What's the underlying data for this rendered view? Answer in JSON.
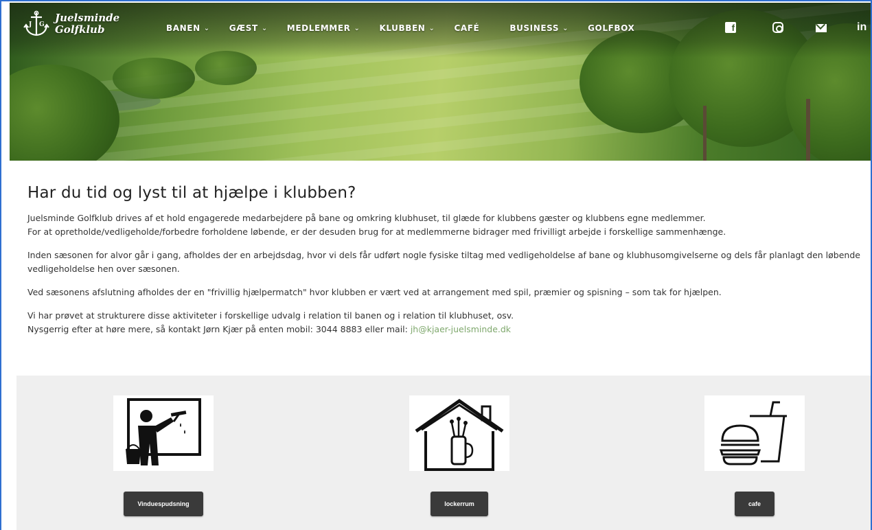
{
  "brand": {
    "line1": "Juelsminde",
    "line2": "Golfklub",
    "initials_left": "J",
    "initials_right": "G"
  },
  "nav": {
    "items": [
      {
        "label": "BANEN",
        "dropdown": true
      },
      {
        "label": "GÆST",
        "dropdown": true
      },
      {
        "label": "MEDLEMMER",
        "dropdown": true
      },
      {
        "label": "KLUBBEN",
        "dropdown": true
      },
      {
        "label": "CAFÉ",
        "dropdown": false
      },
      {
        "label": "BUSINESS",
        "dropdown": true
      },
      {
        "label": "GOLFBOX",
        "dropdown": false
      }
    ],
    "chevron": "⌄",
    "social": {
      "facebook_glyph": "f",
      "linkedin_glyph": "in"
    }
  },
  "main": {
    "title": "Har du tid og lyst til at hjælpe i klubben?",
    "para1_line1": "Juelsminde Golfklub drives af et hold engagerede medarbejdere på bane og omkring klubhuset, til glæde for klubbens gæster og klubbens egne medlemmer.",
    "para1_line2": "For at opretholde/vedligeholde/forbedre forholdene løbende, er der desuden brug for at medlemmerne bidrager med frivilligt arbejde i forskellige sammenhænge.",
    "para2": "Inden sæsonen for alvor går i gang, afholdes der en arbejdsdag, hvor vi dels får udført nogle fysiske tiltag med vedligeholdelse af bane og klubhusomgivelserne og dels får planlagt den løbende vedligeholdelse hen over sæsonen.",
    "para3": "Ved sæsonens afslutning afholdes der en \"frivillig hjælpermatch\" hvor klubben er vært ved at arrangement med spil, præmier og spisning – som tak for hjælpen.",
    "para4_line1": "Vi har prøvet at strukturere disse aktiviteter i forskellige udvalg i relation til banen og i relation til klubhuset, osv.",
    "para4_line2_prefix": "Nysgerrig efter at høre mere, så kontakt Jørn Kjær på enten mobil: 3044 8883 eller mail: ",
    "email": "jh@kjaer-juelsminde.dk"
  },
  "cards": [
    {
      "label": "Vinduespudsning",
      "icon": "window-cleaning-icon"
    },
    {
      "label": "lockerrum",
      "icon": "locker-room-icon"
    },
    {
      "label": "cafe",
      "icon": "cafe-food-icon"
    }
  ],
  "colors": {
    "link": "#7fa86d",
    "button": "#3a3a3a",
    "section_bg": "#efefef"
  }
}
